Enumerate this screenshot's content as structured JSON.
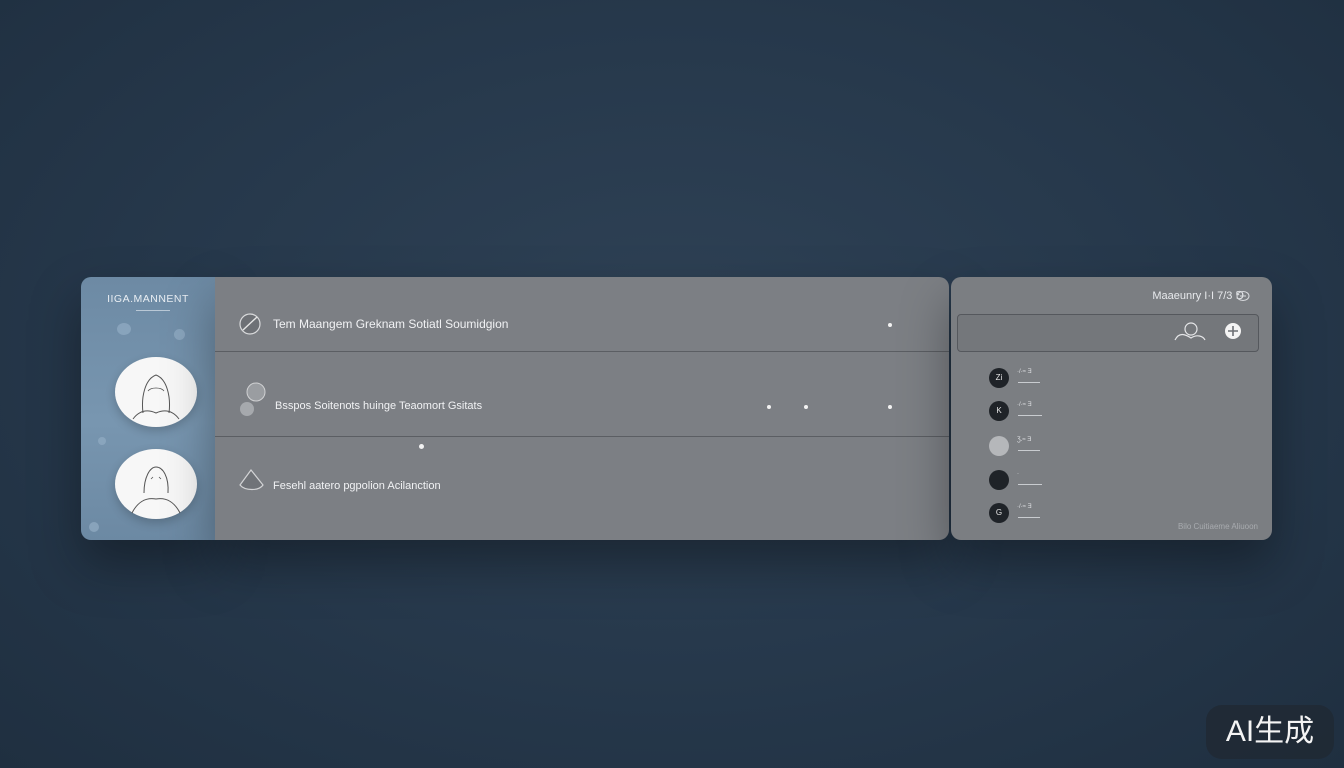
{
  "sidebar": {
    "brand": "IIGA.MANNENT",
    "avatars": [
      {
        "icon": "person-outline-icon"
      },
      {
        "icon": "person-outline-icon"
      }
    ]
  },
  "main": {
    "rows": [
      {
        "label": "Tem Maangem Greknam Sotiatl Soumidgion",
        "icon": "circle-slash-icon"
      },
      {
        "label": "Bsspos Soitenots huinge Teaomort Gsitats",
        "icon": "leaf-icon"
      },
      {
        "label": "Fesehl aatero pgpolion Acilanction",
        "icon": "leaf-icon"
      }
    ]
  },
  "right_panel": {
    "title": "Maaeunry  I·I  7/3  ⅁",
    "search_placeholder": "",
    "contacts": [
      {
        "initials": "Zi",
        "text": "·/·≈ Ǝ"
      },
      {
        "initials": "K",
        "text": "·/·≈ Ǝ"
      },
      {
        "initials": "",
        "text": "Ʒ.≈ Ǝ"
      },
      {
        "initials": "",
        "text": "·"
      },
      {
        "initials": "G",
        "text": "·/·≈ Ǝ"
      }
    ],
    "footer": "Bilo Cuitiaeme Aliuoon"
  },
  "badge": {
    "text": "AI生成"
  },
  "colors": {
    "background": "#26384b",
    "sidebar": "#7290aa",
    "panel": "#7c7f84"
  }
}
